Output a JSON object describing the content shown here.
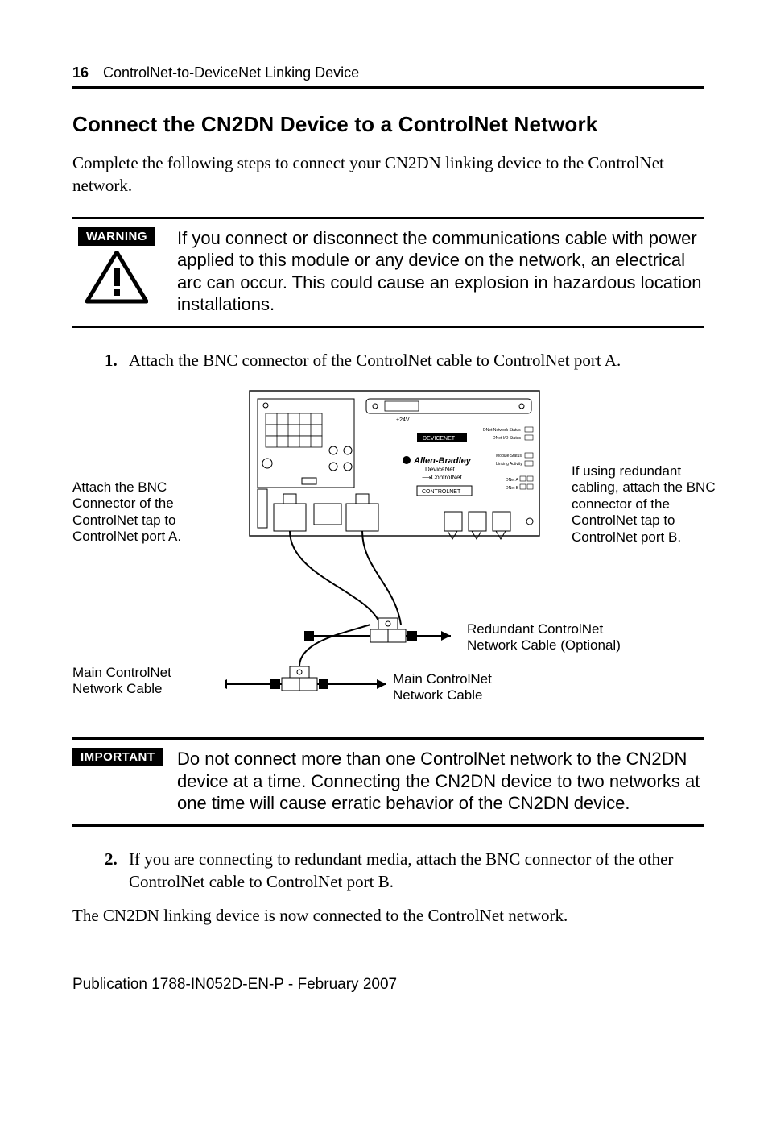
{
  "header": {
    "page_number": "16",
    "running_title": "ControlNet-to-DeviceNet Linking Device"
  },
  "section_title": "Connect the CN2DN Device to a ControlNet Network",
  "intro": "Complete the following steps to connect your CN2DN linking device to the ControlNet network.",
  "warning": {
    "tag": "WARNING",
    "text": "If you connect or disconnect the communications cable with power applied to this module or any device on the network, an electrical arc can occur. This could cause an explosion in hazardous location installations."
  },
  "steps": {
    "s1_num": "1.",
    "s1_text": "Attach the BNC connector of the ControlNet cable to ControlNet port A.",
    "s2_num": "2.",
    "s2_text": "If you are connecting to redundant media, attach the BNC connector of the other ControlNet cable to ControlNet port B."
  },
  "diagram": {
    "left_label": "Attach the BNC Connector of the ControlNet tap to ControlNet port A.",
    "right_label": "If using redundant cabling, attach the BNC connector of the ControlNet tap to ControlNet port B.",
    "redundant_label": "Redundant  ControlNet Network Cable (Optional)",
    "main_left": "Main ControlNet Network Cable",
    "main_right": "Main ControlNet Network Cable",
    "panel": {
      "brand": "Allen-Bradley",
      "line1": "DeviceNet",
      "line2": "ControlNet",
      "box_devicenet": "DEVICENET",
      "box_controlnet": "CONTROLNET",
      "plus24v": "+24V",
      "status1": "DNet Network Status",
      "status2": "DNet I/O Status",
      "status3": "Module Status",
      "status4": "Linking Activity",
      "status5": "DNet A",
      "status6": "DNet B"
    }
  },
  "important": {
    "tag": "IMPORTANT",
    "text": "Do not connect more than one ControlNet network to the CN2DN device at a time. Connecting the CN2DN device to two networks at one time will cause erratic behavior of the CN2DN device."
  },
  "closing": "The CN2DN linking device is now connected to the ControlNet network.",
  "footer": "Publication 1788-IN052D-EN-P - February 2007"
}
